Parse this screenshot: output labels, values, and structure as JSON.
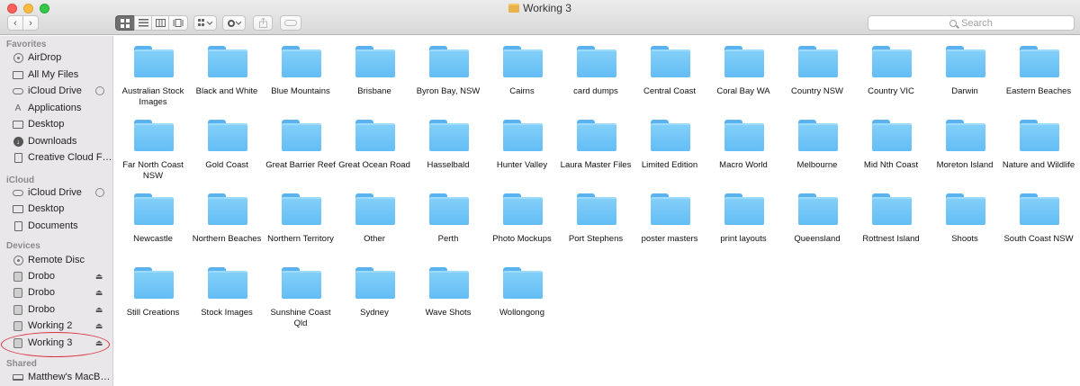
{
  "window": {
    "title": "Working 3"
  },
  "toolbar": {
    "back": "‹",
    "forward": "›",
    "search_placeholder": "Search"
  },
  "sidebar": {
    "favorites_title": "Favorites",
    "favorites": [
      "AirDrop",
      "All My Files",
      "iCloud Drive",
      "Applications",
      "Desktop",
      "Downloads",
      "Creative Cloud Files"
    ],
    "icloud_title": "iCloud",
    "icloud": [
      "iCloud Drive",
      "Desktop",
      "Documents"
    ],
    "devices_title": "Devices",
    "devices": [
      "Remote Disc",
      "Drobo",
      "Drobo",
      "Drobo",
      "Working 2",
      "Working 3"
    ],
    "shared_title": "Shared",
    "shared": [
      "Matthew's MacBo..."
    ]
  },
  "folders": [
    "Australian Stock Images",
    "Black and White",
    "Blue Mountains",
    "Brisbane",
    "Byron Bay, NSW",
    "Cairns",
    "card dumps",
    "Central Coast",
    "Coral Bay WA",
    "Country NSW",
    "Country VIC",
    "Darwin",
    "Eastern Beaches",
    "Far North Coast NSW",
    "Gold Coast",
    "Great Barrier Reef",
    "Great Ocean Road",
    "Hasselbald",
    "Hunter Valley",
    "Laura Master Files",
    "Limited Edition",
    "Macro World",
    "Melbourne",
    "Mid Nth Coast",
    "Moreton Island",
    "Nature and Wildlife",
    "Newcastle",
    "Northern Beaches",
    "Northern Territory",
    "Other",
    "Perth",
    "Photo Mockups",
    "Port Stephens",
    "poster masters",
    "print layouts",
    "Queensland",
    "Rottnest Island",
    "Shoots",
    "South Coast NSW",
    "Still Creations",
    "Stock Images",
    "Sunshine Coast Qld",
    "Sydney",
    "Wave Shots",
    "Wollongong"
  ],
  "colors": {
    "folder": "#6cc3f7",
    "highlight_ring": "#d8343f",
    "sidebar_bg": "#e9e7ea"
  }
}
